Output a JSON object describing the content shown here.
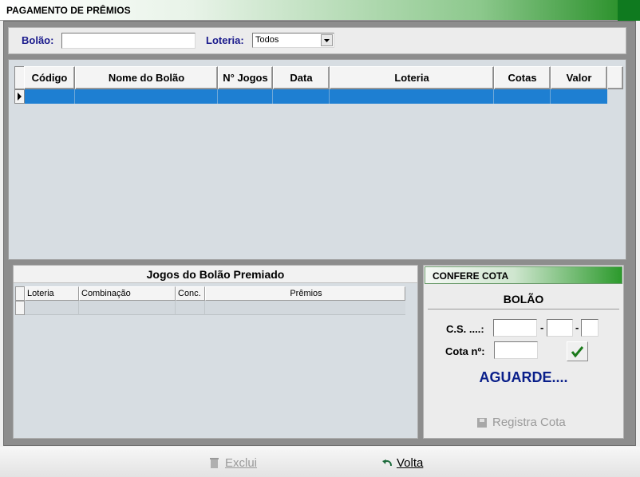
{
  "window": {
    "title": "PAGAMENTO DE PRÊMIOS"
  },
  "filter": {
    "bolao_label": "Bolão:",
    "bolao_value": "",
    "loteria_label": "Loteria:",
    "loteria_selected": "Todos"
  },
  "main_grid": {
    "columns": [
      "Código",
      "Nome do Bolão",
      "N° Jogos",
      "Data",
      "Loteria",
      "Cotas",
      "Valor"
    ]
  },
  "jogos": {
    "title": "Jogos do Bolão Premiado",
    "columns": [
      "Loteria",
      "Combinação",
      "Conc.",
      "Prêmios"
    ]
  },
  "confere": {
    "title": "CONFERE COTA",
    "subtitle": "BOLÃO",
    "cs_label": "C.S. ....:",
    "cota_label": "Cota nº:",
    "status": "AGUARDE....",
    "registra_label": "Registra Cota"
  },
  "footer": {
    "exclui_label": "Exclui",
    "volta_label": "Volta"
  },
  "colors": {
    "title_gradient_end": "#1f8a1f",
    "selected_row": "#1e7fd2",
    "status_text": "#0a1f8a"
  }
}
